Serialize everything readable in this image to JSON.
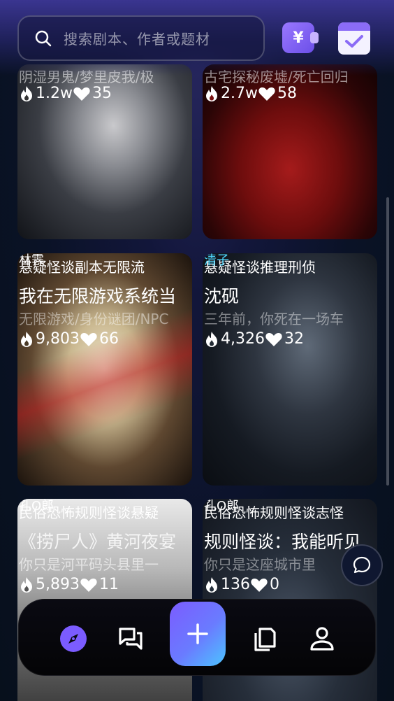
{
  "search": {
    "placeholder": "搜索剧本、作者或题材"
  },
  "header": {
    "wallet_icon_text": "¥"
  },
  "cards": [
    {
      "tag": "",
      "author": "",
      "title": "",
      "desc": "阴湿男鬼/梦里皮我/极",
      "heat": "1.2w",
      "likes": "35"
    },
    {
      "tag": "",
      "author": "",
      "title": "",
      "desc": "古宅探秘废墟/死亡回归",
      "heat": "2.7w",
      "likes": "58"
    },
    {
      "tag": "悬疑怪谈副本无限流",
      "author": "林霁",
      "title": "我在无限游戏系统当",
      "desc": "无限游戏/身份谜团/NPC",
      "heat": "9,803",
      "likes": "66"
    },
    {
      "tag": "悬疑怪谈推理刑侦",
      "author": "清子",
      "title": "沈砚",
      "desc": "三年前，你死在一场车",
      "heat": "4,326",
      "likes": "32"
    },
    {
      "tag": "民俗恐怖规则怪谈悬疑",
      "author": "孔O郎",
      "title": "《捞尸人》黄河夜宴",
      "desc": "你只是河平码头县里一",
      "heat": "5,893",
      "likes": "11"
    },
    {
      "tag": "民俗恐怖规则怪谈志怪",
      "author": "孔O郎",
      "title": "规则怪谈：我能听见",
      "desc": "你只是这座城市里",
      "heat": "136",
      "likes": "0"
    }
  ],
  "nav": {
    "items": [
      "discover-icon",
      "chat-icon",
      "add-icon",
      "library-icon",
      "profile-icon"
    ],
    "accent": "#7b5cff"
  },
  "colors": {
    "accent": "#7b5cff",
    "author_teal": "#4fd8ff"
  }
}
